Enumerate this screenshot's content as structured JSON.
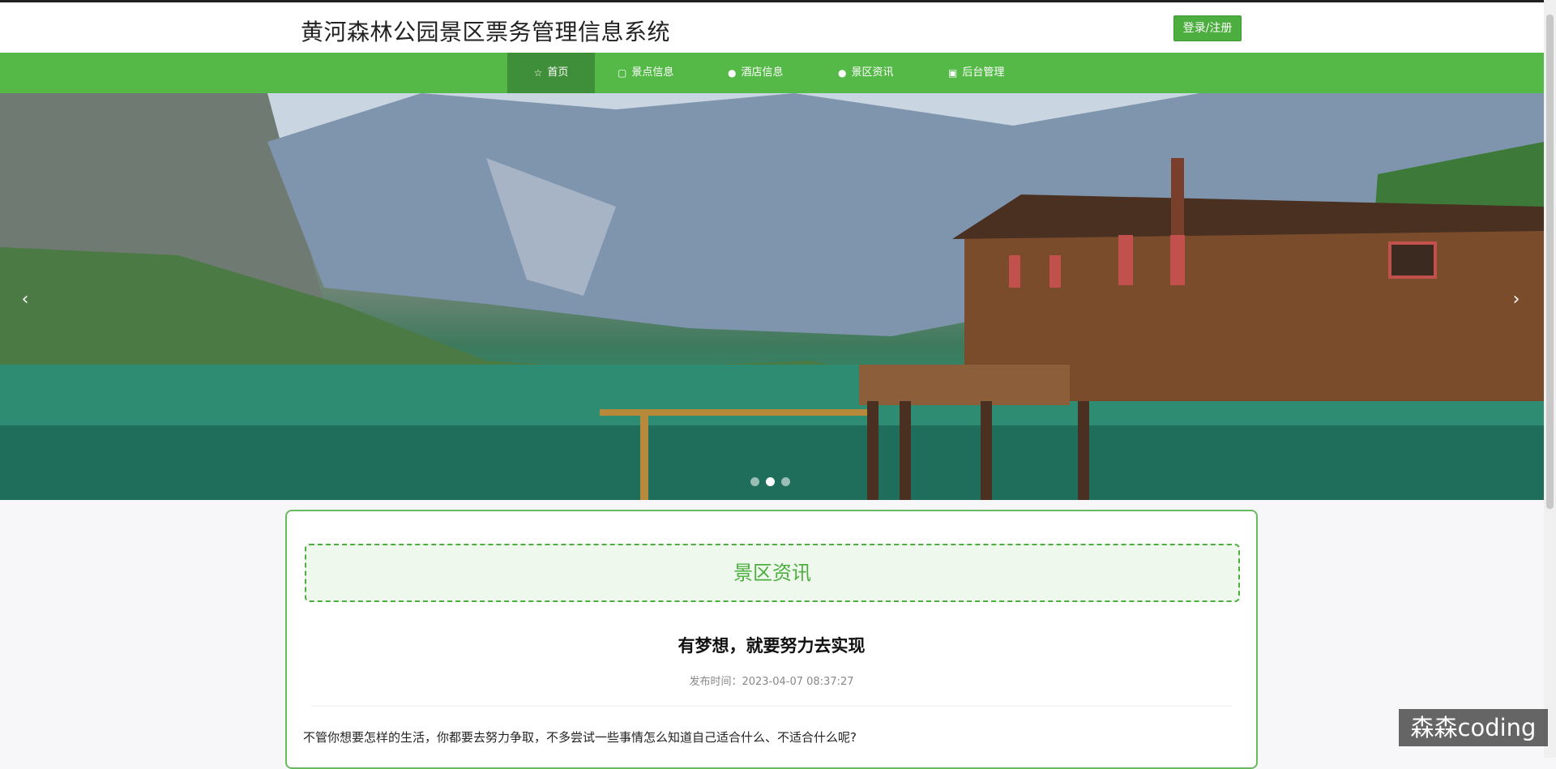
{
  "header": {
    "site_title": "黄河森林公园景区票务管理信息系统",
    "login_label": "登录/注册"
  },
  "nav": {
    "items": [
      {
        "label": "首页",
        "icon": "star-icon",
        "active": true
      },
      {
        "label": "景点信息",
        "icon": "bag-icon",
        "active": false
      },
      {
        "label": "酒店信息",
        "icon": "info-circle-icon",
        "active": false
      },
      {
        "label": "景区资讯",
        "icon": "circle-icon",
        "active": false
      },
      {
        "label": "后台管理",
        "icon": "briefcase-icon",
        "active": false
      }
    ]
  },
  "banner": {
    "prev_arrow": "‹",
    "next_arrow": "›",
    "slide_count": 3,
    "active_slide": 2
  },
  "news": {
    "section_title": "景区资讯",
    "article_title": "有梦想，就要努力去实现",
    "date_label": "发布时间：",
    "date_value": "2023-04-07 08:37:27",
    "body": "不管你想要怎样的生活，你都要去努力争取，不多尝试一些事情怎么知道自己适合什么、不适合什么呢?"
  },
  "watermark": {
    "text": "森森coding"
  },
  "colors": {
    "brand_green": "#55b947",
    "active_nav": "#3f8f3a",
    "button_green": "#4cae3f"
  }
}
